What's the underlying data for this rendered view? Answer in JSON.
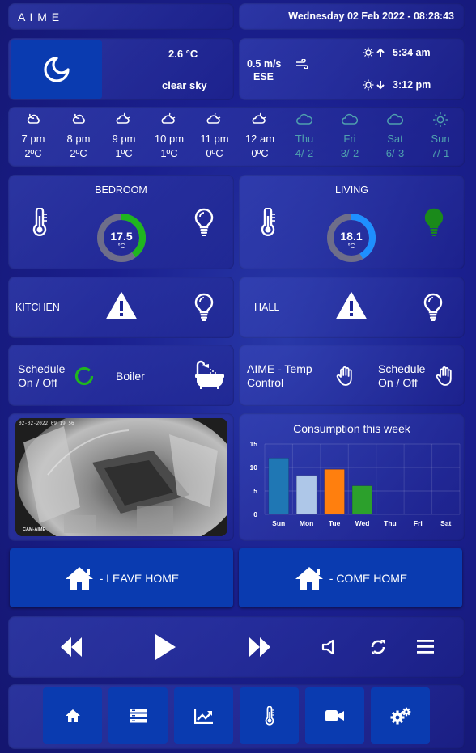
{
  "header": {
    "app_title": "A I M E",
    "datetime": "Wednesday 02 Feb 2022 - 08:28:43"
  },
  "weather": {
    "temperature": "2.6 °C",
    "condition": "clear sky",
    "wind_speed": "0.5 m/s",
    "wind_direction": "ESE",
    "sunrise": "5:34 am",
    "sunset": "3:12 pm"
  },
  "forecast": [
    {
      "time": "7 pm",
      "temp": "2ºC",
      "icon": "moon-cloud-icon"
    },
    {
      "time": "8 pm",
      "temp": "2ºC",
      "icon": "moon-cloud-icon"
    },
    {
      "time": "9 pm",
      "temp": "1ºC",
      "icon": "cloud-moon-icon"
    },
    {
      "time": "10 pm",
      "temp": "1ºC",
      "icon": "cloud-moon-icon"
    },
    {
      "time": "11 pm",
      "temp": "0ºC",
      "icon": "cloud-moon-icon"
    },
    {
      "time": "12 am",
      "temp": "0ºC",
      "icon": "cloud-moon-icon"
    },
    {
      "time": "Thu",
      "temp": "4/-2",
      "icon": "cloud-icon"
    },
    {
      "time": "Fri",
      "temp": "3/-2",
      "icon": "cloud-icon"
    },
    {
      "time": "Sat",
      "temp": "6/-3",
      "icon": "cloud-icon"
    },
    {
      "time": "Sun",
      "temp": "7/-1",
      "icon": "sun-icon"
    }
  ],
  "rooms": {
    "bedroom": {
      "name": "BEDROOM",
      "temp": "17.5",
      "unit": "°C",
      "gauge_fraction": 0.4,
      "gauge_color": "#1fb61f",
      "light_color": "#ffffff"
    },
    "living": {
      "name": "LIVING",
      "temp": "18.1",
      "unit": "°C",
      "gauge_fraction": 0.42,
      "gauge_color": "#1e8fff",
      "light_color": "#1a8a1a"
    },
    "kitchen": {
      "name": "KITCHEN"
    },
    "hall": {
      "name": "HALL"
    }
  },
  "controls": {
    "schedule_label_1": "Schedule",
    "schedule_label_2": "On / Off",
    "boiler_label": "Boiler",
    "aime_label_1": "AIME - Temp",
    "aime_label_2": "Control",
    "schedule2_label_1": "Schedule",
    "schedule2_label_2": "On / Off"
  },
  "camera": {
    "timestamp": "02-02-2022 09 19 56",
    "label": "CAM-AIME"
  },
  "chart_data": {
    "type": "bar",
    "title": "Consumption this week",
    "categories": [
      "Sun",
      "Mon",
      "Tue",
      "Wed",
      "Thu",
      "Fri",
      "Sat"
    ],
    "values": [
      12,
      8.3,
      9.6,
      6.1,
      null,
      null,
      null
    ],
    "colors": [
      "#1f77b4",
      "#aec7e8",
      "#ff7f0e",
      "#2ca02c",
      "#d62728",
      "#9467bd",
      "#8c564b"
    ],
    "ylim": [
      0,
      15
    ],
    "yticks": [
      0,
      5,
      10,
      15
    ],
    "grid": true,
    "xlabel": "",
    "ylabel": ""
  },
  "scenes": {
    "leave_home": "- LEAVE HOME",
    "come_home": "- COME HOME"
  },
  "colors": {
    "button_blue": "#0a3bb0",
    "accent_green": "#1fb61f",
    "accent_blue": "#1e8fff",
    "dim_teal": "#4fa0ae"
  }
}
